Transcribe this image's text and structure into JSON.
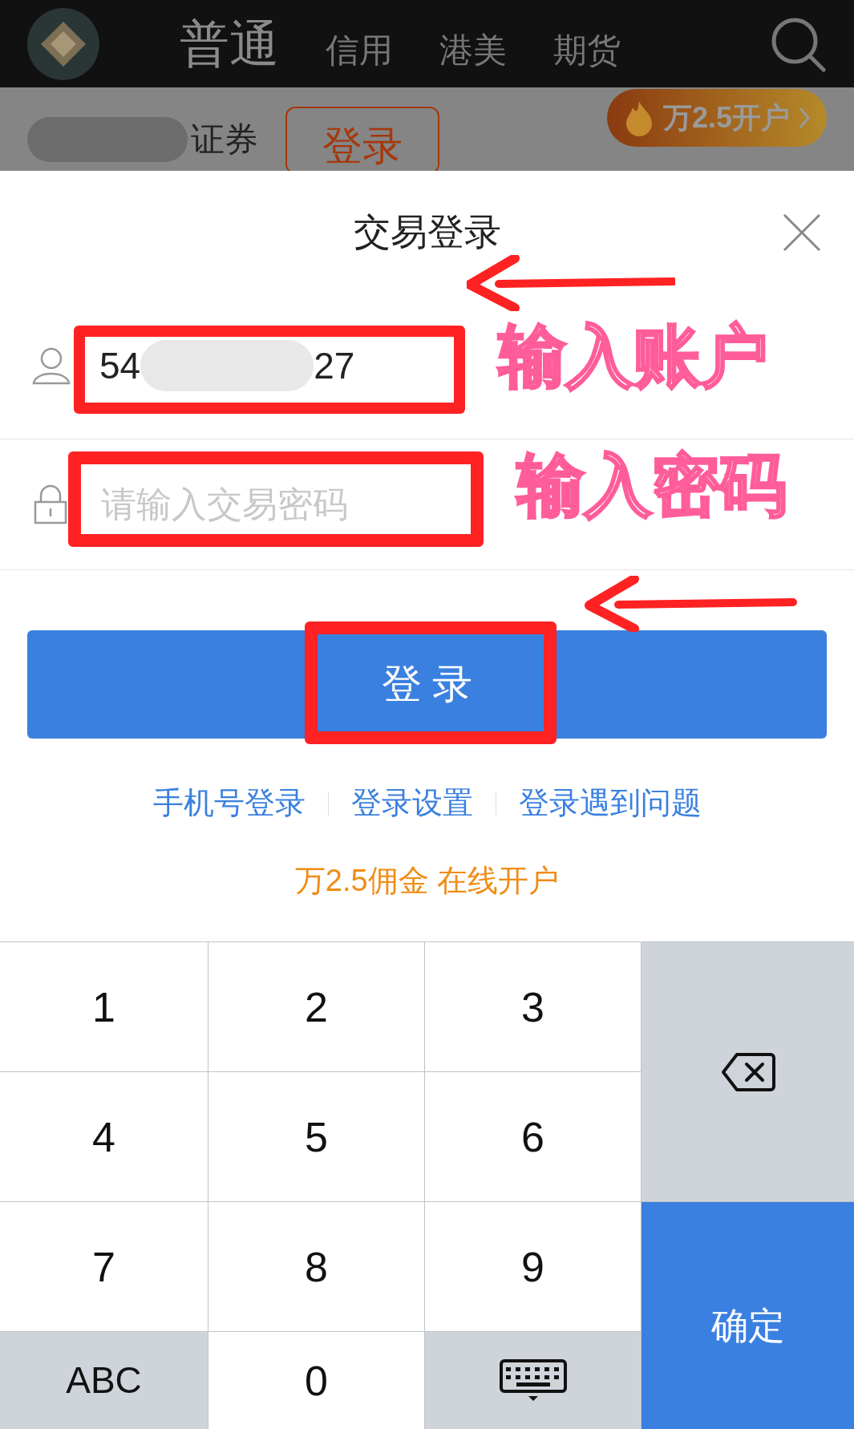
{
  "top_nav": {
    "tabs": [
      {
        "label": "普通",
        "selected": true
      },
      {
        "label": "信用",
        "selected": false
      },
      {
        "label": "港美",
        "selected": false
      },
      {
        "label": "期货",
        "selected": false
      }
    ]
  },
  "broker_bar": {
    "name": "证券",
    "login_button": "登录",
    "promo": "万2.5开户"
  },
  "dialog": {
    "title": "交易登录",
    "account": {
      "value_start": "54",
      "value_end": "27"
    },
    "password": {
      "placeholder": "请输入交易密码"
    },
    "login_button": "登 录",
    "links": [
      "手机号登录",
      "登录设置",
      "登录遇到问题"
    ],
    "promo": "万2.5佣金 在线开户"
  },
  "keypad": {
    "keys": [
      {
        "kind": "digit",
        "label": "1"
      },
      {
        "kind": "digit",
        "label": "2"
      },
      {
        "kind": "digit",
        "label": "3"
      },
      {
        "kind": "backspace"
      },
      {
        "kind": "digit",
        "label": "4"
      },
      {
        "kind": "digit",
        "label": "5"
      },
      {
        "kind": "digit",
        "label": "6"
      },
      {
        "kind": "digit",
        "label": "7"
      },
      {
        "kind": "digit",
        "label": "8"
      },
      {
        "kind": "digit",
        "label": "9"
      },
      {
        "kind": "confirm",
        "label": "确定"
      },
      {
        "kind": "mode",
        "label": "ABC"
      },
      {
        "kind": "digit",
        "label": "0"
      },
      {
        "kind": "hide"
      }
    ]
  },
  "annotations": {
    "account_label": "输入账户",
    "password_label": "输入密码"
  }
}
